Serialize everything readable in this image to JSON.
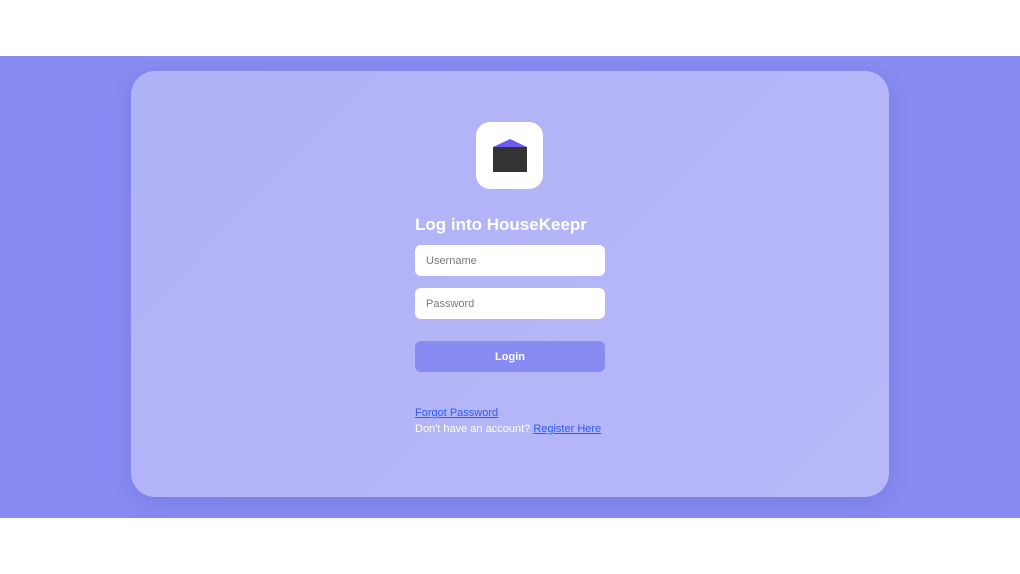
{
  "app": {
    "name": "HouseKeepr",
    "logo_icon": "house-box-icon"
  },
  "colors": {
    "background": "#888cf2",
    "card": "#b3b5f7",
    "accent": "#888cf2",
    "link": "#2f5cf0",
    "logo_roof": "#6a5cf0",
    "logo_body": "#333333"
  },
  "login": {
    "title": "Log into HouseKeepr",
    "username_placeholder": "Username",
    "password_placeholder": "Password",
    "submit_label": "Login",
    "forgot_password": "Forgot Password",
    "register_prompt": "Don't have an account?",
    "register_link": "Register Here"
  }
}
